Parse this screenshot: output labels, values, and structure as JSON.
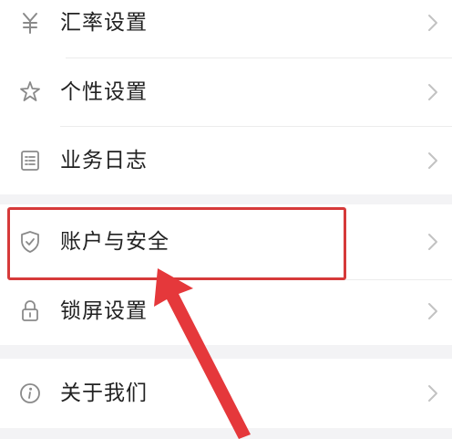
{
  "menu": {
    "group1": [
      {
        "icon": "yen-currency-icon",
        "label": "汇率设置"
      },
      {
        "icon": "sparkle-star-icon",
        "label": "个性设置"
      },
      {
        "icon": "document-list-icon",
        "label": "业务日志"
      }
    ],
    "group2": [
      {
        "icon": "shield-check-icon",
        "label": "账户与安全"
      },
      {
        "icon": "padlock-icon",
        "label": "锁屏设置"
      }
    ],
    "group3": [
      {
        "icon": "info-circle-icon",
        "label": "关于我们"
      }
    ]
  },
  "annotation": {
    "highlight_color": "#d63a3a",
    "arrow_color": "#e5383b"
  },
  "colors": {
    "background": "#f3f3f5",
    "row_background": "#ffffff",
    "icon": "#8a8a8a",
    "text": "#222222",
    "chevron": "#c2c2c2"
  }
}
